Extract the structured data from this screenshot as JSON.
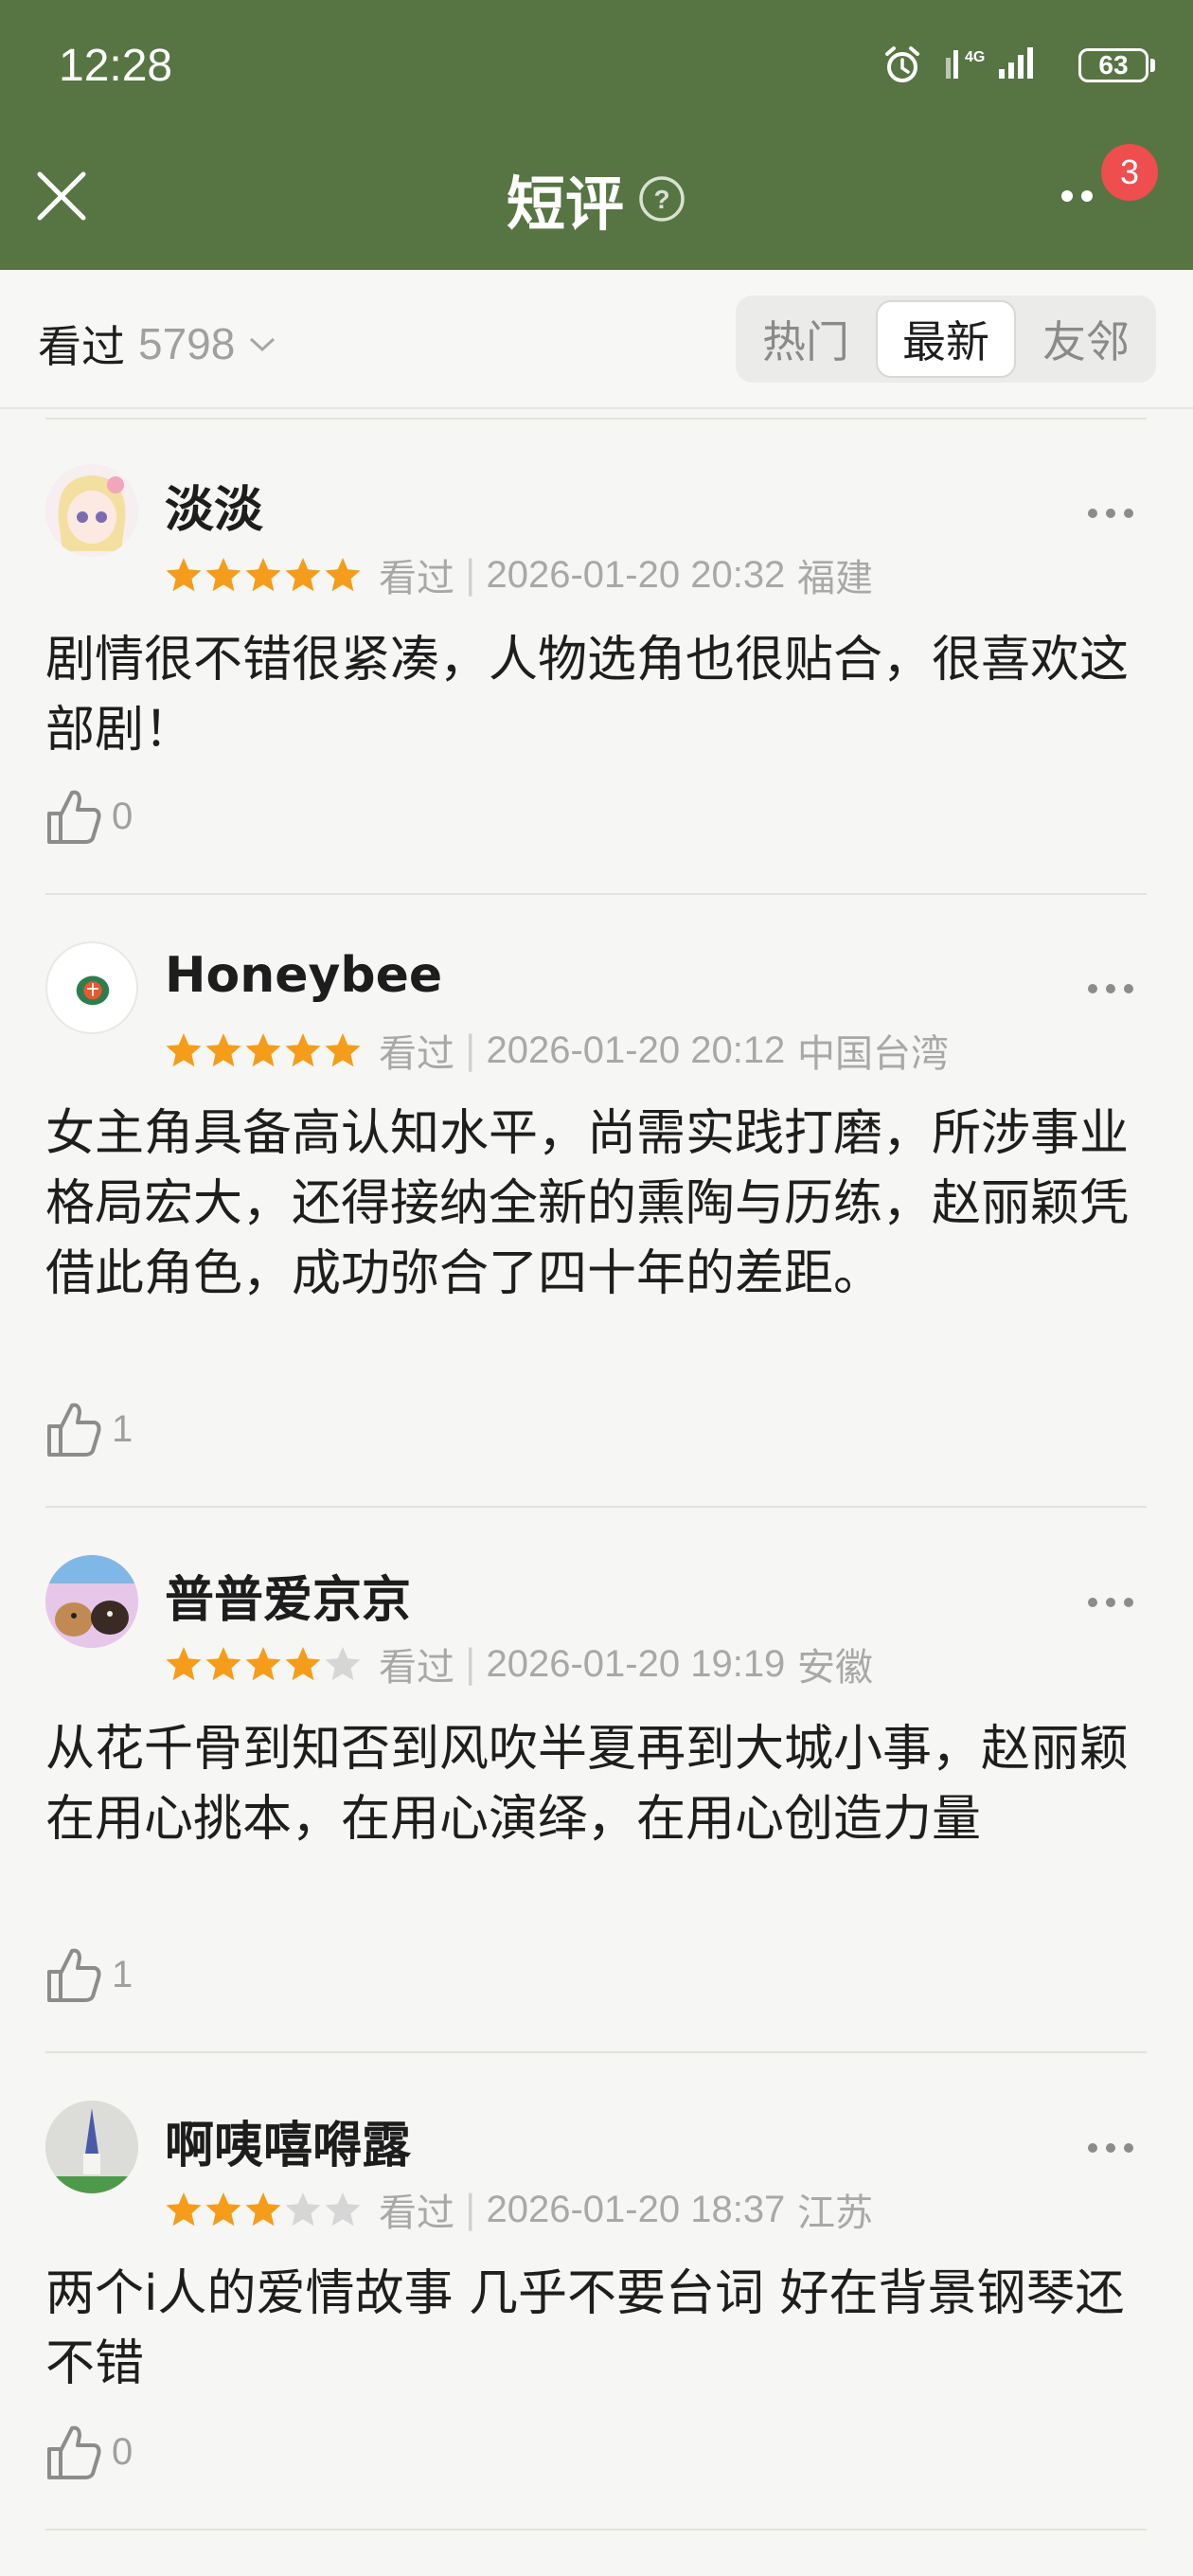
{
  "status_bar": {
    "time": "12:28",
    "network": "4G",
    "battery": "63"
  },
  "header": {
    "title": "短评",
    "badge_count": "3"
  },
  "filter": {
    "watched_label": "看过",
    "watched_count": "5798",
    "tabs": [
      "热门",
      "最新",
      "友邻"
    ],
    "active_tab": "最新"
  },
  "reviews": [
    {
      "username": "淡淡",
      "rating": 5,
      "status": "看过",
      "date": "2026-01-20 20:32",
      "location": "福建",
      "content": "剧情很不错很紧凑，人物选角也很贴合，很喜欢这部剧！",
      "likes": "0"
    },
    {
      "username": "Honeybee",
      "rating": 5,
      "status": "看过",
      "date": "2026-01-20 20:12",
      "location": "中国台湾",
      "content": "女主角具备高认知水平，尚需实践打磨，所涉事业格局宏大，还得接纳全新的熏陶与历练，赵丽颖凭借此角色，成功弥合了四十年的差距。",
      "likes": "1"
    },
    {
      "username": "普普爱京京",
      "rating": 4,
      "status": "看过",
      "date": "2026-01-20 19:19",
      "location": "安徽",
      "content": "从花千骨到知否到风吹半夏再到大城小事，赵丽颖在用心挑本，在用心演绎，在用心创造力量",
      "likes": "1"
    },
    {
      "username": "啊咦嘻嘚露",
      "rating": 3,
      "status": "看过",
      "date": "2026-01-20 18:37",
      "location": "江苏",
      "content": "两个i人的爱情故事 几乎不要台词 好在背景钢琴还不错",
      "likes": "0"
    }
  ],
  "colors": {
    "header_bg": "#567543",
    "star": "#f59d1a",
    "star_empty": "#d6d6d6",
    "badge": "#ee4e4e"
  }
}
